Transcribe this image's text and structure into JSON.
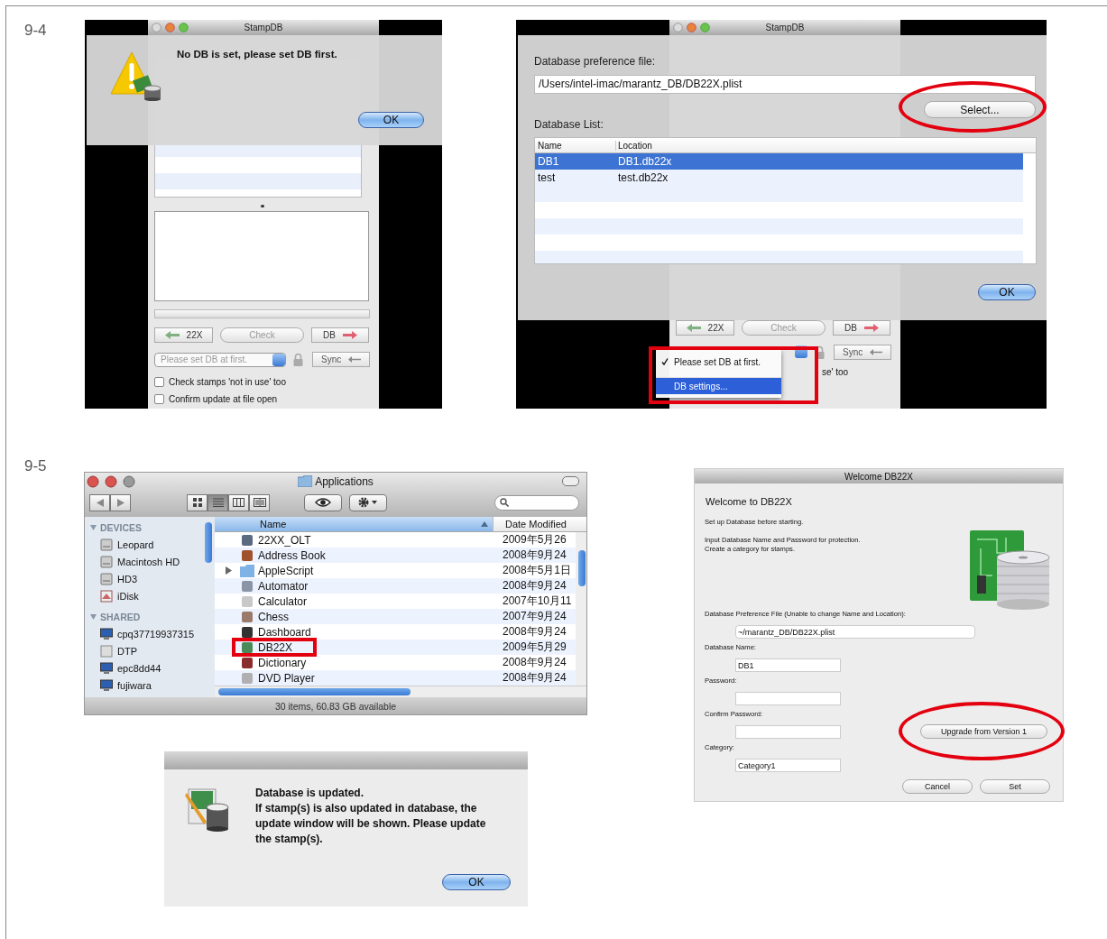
{
  "figure_9_4": {
    "label": "9-4",
    "alert_screen": {
      "window_title": "StampDB",
      "message": "No DB is set, please set DB first.",
      "ok_button": "OK",
      "buttons": [
        {
          "label": "22X",
          "kind": "back",
          "disabled": false
        },
        {
          "label": "Check",
          "kind": "plain",
          "disabled": true
        },
        {
          "label": "DB",
          "kind": "forward",
          "disabled": false
        }
      ],
      "popup": {
        "value": "Please set DB at first.",
        "disabled": true
      },
      "sync_button": "Sync",
      "checkboxes": [
        {
          "label": "Check stamps 'not in use' too",
          "checked": false
        },
        {
          "label": "Confirm update at file open",
          "checked": false
        }
      ]
    },
    "settings_screen": {
      "window_title": "StampDB",
      "pref_label": "Database preference file:",
      "pref_value": "/Users/intel-imac/marantz_DB/DB22X.plist",
      "select_button": {
        "label": "Select...",
        "circled": true
      },
      "list_label": "Database List:",
      "columns": [
        "Name",
        "Location"
      ],
      "rows": [
        {
          "name": "DB1",
          "location": "DB1.db22x",
          "selected": true
        },
        {
          "name": "test",
          "location": "test.db22x",
          "selected": false
        }
      ],
      "ok_button": "OK",
      "buttons": [
        {
          "label": "22X",
          "kind": "back",
          "disabled": false
        },
        {
          "label": "Check",
          "kind": "plain",
          "disabled": true
        },
        {
          "label": "DB",
          "kind": "forward",
          "disabled": false
        }
      ],
      "sync_button": "Sync",
      "partial_text": "se' too",
      "menu": {
        "boxed": true,
        "items": [
          {
            "label": "Please set DB at first.",
            "checked": true,
            "selected": false
          },
          {
            "label": "DB settings...",
            "checked": false,
            "selected": true
          }
        ]
      }
    }
  },
  "figure_9_5": {
    "label": "9-5",
    "finder": {
      "window_title": "Applications",
      "view_buttons": [
        {
          "kind": "icons",
          "selected": false
        },
        {
          "kind": "list",
          "selected": true
        },
        {
          "kind": "columns",
          "selected": false
        },
        {
          "kind": "coverflow",
          "selected": false
        }
      ],
      "sidebar": [
        {
          "heading": "DEVICES",
          "items": [
            {
              "label": "Leopard",
              "kind": "drive"
            },
            {
              "label": "Macintosh HD",
              "kind": "drive"
            },
            {
              "label": "HD3",
              "kind": "drive"
            },
            {
              "label": "iDisk",
              "kind": "idisk"
            }
          ]
        },
        {
          "heading": "SHARED",
          "items": [
            {
              "label": "cpq37719937315",
              "kind": "monitor"
            },
            {
              "label": "DTP",
              "kind": "server"
            },
            {
              "label": "epc8dd44",
              "kind": "monitor"
            },
            {
              "label": "fujiwara",
              "kind": "monitor"
            }
          ]
        }
      ],
      "columns": [
        {
          "label": "Name",
          "sorted": true
        },
        {
          "label": "Date Modified",
          "sorted": false
        }
      ],
      "rows": [
        {
          "name": "22XX_OLT",
          "date": "2009年5月26",
          "kind": "app",
          "color": "#5a6a80",
          "boxed": false
        },
        {
          "name": "Address Book",
          "date": "2008年9月24",
          "kind": "app",
          "color": "#a0522d",
          "boxed": false
        },
        {
          "name": "AppleScript",
          "date": "2008年5月1日",
          "kind": "folder",
          "color": "#7fb2e5",
          "boxed": false
        },
        {
          "name": "Automator",
          "date": "2008年9月24",
          "kind": "app",
          "color": "#8a96a8",
          "boxed": false
        },
        {
          "name": "Calculator",
          "date": "2007年10月11",
          "kind": "app",
          "color": "#c8c8c8",
          "boxed": false
        },
        {
          "name": "Chess",
          "date": "2007年9月24",
          "kind": "app",
          "color": "#9a7a6a",
          "boxed": false
        },
        {
          "name": "Dashboard",
          "date": "2008年9月24",
          "kind": "app",
          "color": "#333333",
          "boxed": false
        },
        {
          "name": "DB22X",
          "date": "2009年5月29",
          "kind": "app",
          "color": "#4a8a5a",
          "boxed": true
        },
        {
          "name": "Dictionary",
          "date": "2008年9月24",
          "kind": "app",
          "color": "#8b2c2c",
          "boxed": false
        },
        {
          "name": "DVD Player",
          "date": "2008年9月24",
          "kind": "app",
          "color": "#b0b0b0",
          "boxed": false
        }
      ],
      "status": "30 items, 60.83 GB available"
    },
    "welcome_dialog": {
      "window_title": "Welcome DB22X",
      "heading": "Welcome to DB22X",
      "intro": "Set up Database before starting.",
      "info_lines": [
        "Input Database Name and Password for protection.",
        "Create a category for stamps."
      ],
      "fields": [
        {
          "label": "Database Preference File (Unable to change Name and Location):",
          "value": "~/marantz_DB/DB22X.plist",
          "kind": "wide"
        },
        {
          "label": "Database Name:",
          "value": "DB1",
          "kind": "short"
        },
        {
          "label": "Password:",
          "kind": "short"
        },
        {
          "label": "Confirm Password:",
          "kind": "short"
        },
        {
          "label": "Category:",
          "value": "Category1",
          "kind": "short"
        }
      ],
      "upgrade_button": {
        "label": "Upgrade from Version 1",
        "circled": true
      },
      "buttons": [
        "Cancel",
        "Set"
      ]
    },
    "updated_dialog": {
      "heading": "Database is updated.",
      "message": "If stamp(s) is also updated in database, the update window will be shown. Please update the stamp(s).",
      "ok_button": "OK"
    }
  }
}
